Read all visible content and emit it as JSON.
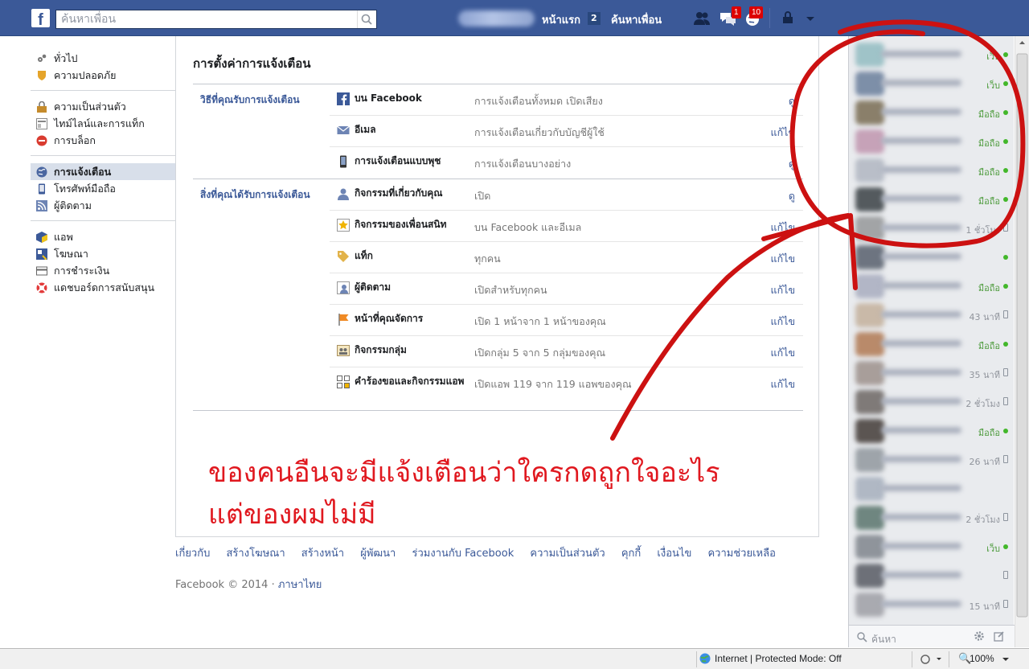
{
  "header": {
    "search_placeholder": "ค้นหาเพื่อน",
    "home_label": "หน้าแรก",
    "home_count": "2",
    "find_friends_label": "ค้นหาเพื่อน",
    "messages_badge": "1",
    "notifications_badge": "10"
  },
  "sidebar": {
    "groups": [
      [
        {
          "label": "ทั่วไป",
          "icon": "gears-icon"
        },
        {
          "label": "ความปลอดภัย",
          "icon": "shield-icon"
        }
      ],
      [
        {
          "label": "ความเป็นส่วนตัว",
          "icon": "lock-icon"
        },
        {
          "label": "ไทม์ไลน์และการแท็ก",
          "icon": "timeline-icon"
        },
        {
          "label": "การบล็อก",
          "icon": "block-icon"
        }
      ],
      [
        {
          "label": "การแจ้งเตือน",
          "icon": "globe-icon",
          "selected": true
        },
        {
          "label": "โทรศัพท์มือถือ",
          "icon": "phone-icon"
        },
        {
          "label": "ผู้ติดตาม",
          "icon": "rss-icon"
        }
      ],
      [
        {
          "label": "แอพ",
          "icon": "cube-icon"
        },
        {
          "label": "โฆษณา",
          "icon": "ads-icon"
        },
        {
          "label": "การชำระเงิน",
          "icon": "card-icon"
        },
        {
          "label": "แดชบอร์ดการสนับสนุน",
          "icon": "lifebuoy-icon"
        }
      ]
    ]
  },
  "main": {
    "title": "การตั้งค่าการแจ้งเตือน",
    "sections": [
      {
        "label": "วิธีที่คุณรับการแจ้งเตือน",
        "rows": [
          {
            "label": "บน Facebook",
            "value": "การแจ้งเตือนทั้งหมด เปิดเสียง",
            "action": "ดู",
            "icon": "facebook-icon"
          },
          {
            "label": "อีเมล",
            "value": "การแจ้งเตือนเกี่ยวกับบัญชีผู้ใช้",
            "action": "แก้ไข",
            "icon": "envelope-icon"
          },
          {
            "label": "การแจ้งเตือนแบบพุช",
            "value": "การแจ้งเตือนบางอย่าง",
            "action": "ดู",
            "icon": "mobile-icon"
          }
        ]
      },
      {
        "label": "สิ่งที่คุณได้รับการแจ้งเตือน",
        "rows": [
          {
            "label": "กิจกรรมที่เกี่ยวกับคุณ",
            "value": "เปิด",
            "action": "ดู",
            "icon": "person-icon"
          },
          {
            "label": "กิจกรรมของเพื่อนสนิท",
            "value": "บน Facebook และอีเมล",
            "action": "แก้ไข",
            "icon": "star-icon"
          },
          {
            "label": "แท็ก",
            "value": "ทุกคน",
            "action": "แก้ไข",
            "icon": "tag-icon"
          },
          {
            "label": "ผู้ติดตาม",
            "value": "เปิดสำหรับทุกคน",
            "action": "แก้ไข",
            "icon": "followers-icon"
          },
          {
            "label": "หน้าที่คุณจัดการ",
            "value": "เปิด 1 หน้าจาก 1 หน้าของคุณ",
            "action": "แก้ไข",
            "icon": "flag-icon"
          },
          {
            "label": "กิจกรรมกลุ่ม",
            "value": "เปิดกลุ่ม 5 จาก 5 กลุ่มของคุณ",
            "action": "แก้ไข",
            "icon": "group-icon"
          },
          {
            "label": "คำร้องขอและกิจกรรมแอพ",
            "value": "เปิดแอพ 119 จาก 119 แอพของคุณ",
            "action": "แก้ไข",
            "icon": "apps-icon"
          }
        ]
      }
    ],
    "annotation_line1": "ของคนอืนจะมีแจ้งเตือนว่าใครกดถูกใจอะไร",
    "annotation_line2": "แต่ของผมไม่มี"
  },
  "footer": {
    "links": [
      "เกี่ยวกับ",
      "สร้างโฆษณา",
      "สร้างหน้า",
      "ผู้พัฒนา",
      "ร่วมงานกับ Facebook",
      "ความเป็นส่วนตัว",
      "คุกกี้",
      "เงื่อนไข",
      "ความช่วยเหลือ"
    ],
    "copyright": "Facebook © 2014 ·",
    "language": "ภาษาไทย"
  },
  "chat": {
    "contacts": [
      {
        "status": "เว็บ",
        "indicator": "online",
        "avatar_color": "#9fc3c8"
      },
      {
        "status": "เว็บ",
        "indicator": "online",
        "avatar_color": "#7d8fa8"
      },
      {
        "status": "มือถือ",
        "indicator": "online",
        "avatar_color": "#8a7f6a"
      },
      {
        "status": "มือถือ",
        "indicator": "online",
        "avatar_color": "#c6a2b8"
      },
      {
        "status": "มือถือ",
        "indicator": "online",
        "avatar_color": "#b9bec8"
      },
      {
        "status": "มือถือ",
        "indicator": "online",
        "avatar_color": "#545a5e"
      },
      {
        "status": "1 ชั่วโมง",
        "indicator": "idle",
        "avatar_color": "#a2a4a6"
      },
      {
        "status": "",
        "indicator": "online",
        "avatar_color": "#6d7480"
      },
      {
        "status": "มือถือ",
        "indicator": "online",
        "avatar_color": "#b2b6c6"
      },
      {
        "status": "43 นาที",
        "indicator": "idle",
        "avatar_color": "#c9b9a8"
      },
      {
        "status": "มือถือ",
        "indicator": "online",
        "avatar_color": "#b98a6a"
      },
      {
        "status": "35 นาที",
        "indicator": "idle",
        "avatar_color": "#a89e9a"
      },
      {
        "status": "2 ชั่วโมง",
        "indicator": "idle",
        "avatar_color": "#7f7a78"
      },
      {
        "status": "มือถือ",
        "indicator": "online",
        "avatar_color": "#5b5552"
      },
      {
        "status": "26 นาที",
        "indicator": "idle",
        "avatar_color": "#9ea4aa"
      },
      {
        "status": "",
        "indicator": "none",
        "avatar_color": "#b0b8c4"
      },
      {
        "status": "2 ชั่วโมง",
        "indicator": "idle",
        "avatar_color": "#6f8680"
      },
      {
        "status": "เว็บ",
        "indicator": "online",
        "avatar_color": "#8f949b"
      },
      {
        "status": "",
        "indicator": "idle",
        "avatar_color": "#6d7078"
      },
      {
        "status": "15 นาที",
        "indicator": "idle",
        "avatar_color": "#a9aab0"
      }
    ],
    "search_placeholder": "ค้นหา"
  },
  "statusbar": {
    "zone": "Internet | Protected Mode: Off",
    "zoom": "100%"
  },
  "colors": {
    "brand_blue": "#3b5998",
    "annotation_red": "#e0181f",
    "online_green": "#42b72a"
  }
}
